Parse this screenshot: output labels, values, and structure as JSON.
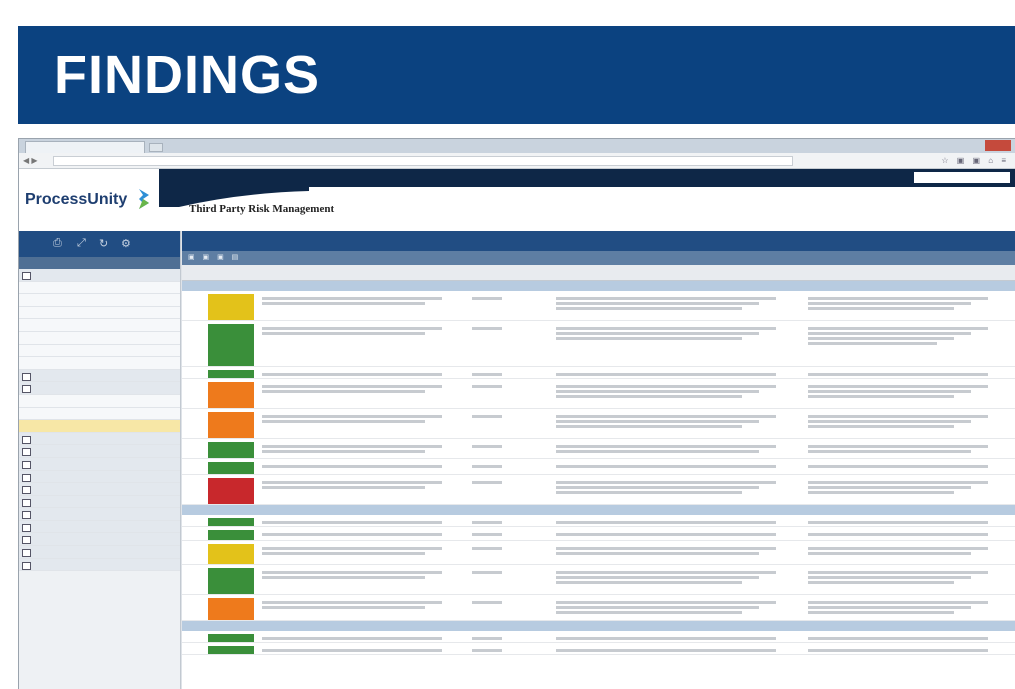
{
  "slide": {
    "title": "FINDINGS"
  },
  "browser": {
    "tab_label": "",
    "url": ""
  },
  "app": {
    "logo_text": "ProcessUnity",
    "page_title": "Third Party Risk Management"
  },
  "colors": {
    "banner": "#0b4280",
    "nav_dark": "#0e2747",
    "section_header": "#214d83",
    "severity_green": "#3a8f3a",
    "severity_yellow": "#e3c21a",
    "severity_orange": "#ee7a1c",
    "severity_red": "#c8282c",
    "sidebar_selected": "#f7e7a6"
  },
  "severity_legend": [
    "green",
    "yellow",
    "orange",
    "red"
  ],
  "findings_rows": [
    {
      "severity": "yellow",
      "h": 30
    },
    {
      "severity": "green",
      "h": 46
    },
    {
      "severity": "green",
      "h": 12
    },
    {
      "severity": "orange",
      "h": 30
    },
    {
      "severity": "orange",
      "h": 30
    },
    {
      "severity": "green",
      "h": 20
    },
    {
      "severity": "green",
      "h": 16
    },
    {
      "severity": "red",
      "h": 30
    }
  ],
  "findings_rows_2": [
    {
      "severity": "green",
      "h": 12
    },
    {
      "severity": "green",
      "h": 14
    },
    {
      "severity": "yellow",
      "h": 24
    },
    {
      "severity": "green",
      "h": 30
    },
    {
      "severity": "orange",
      "h": 26
    }
  ],
  "findings_rows_3": [
    {
      "severity": "green",
      "h": 12
    },
    {
      "severity": "green",
      "h": 12
    }
  ]
}
